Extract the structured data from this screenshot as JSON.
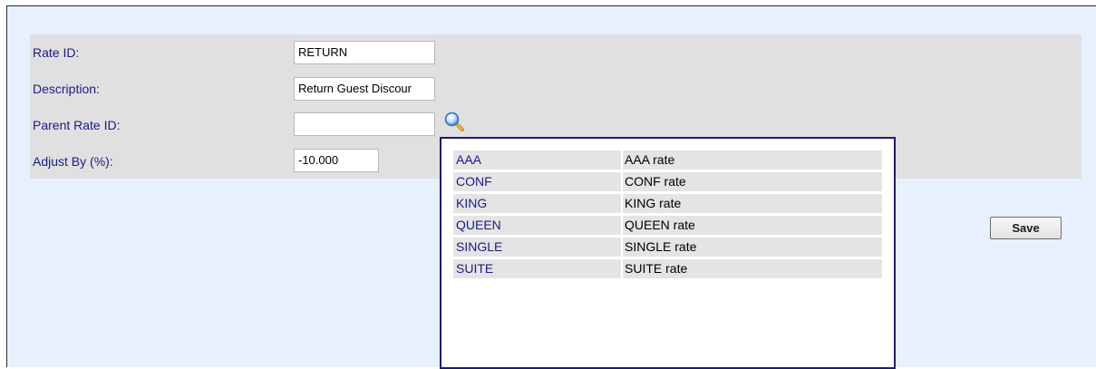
{
  "form": {
    "rate_id": {
      "label": "Rate ID:",
      "value": "RETURN"
    },
    "description": {
      "label": "Description:",
      "value": "Return Guest Discour"
    },
    "parent_rate_id": {
      "label": "Parent Rate ID:",
      "value": ""
    },
    "adjust_by": {
      "label": "Adjust By (%):",
      "value": "-10.000"
    }
  },
  "lookup": {
    "icon": "magnifier-search-icon",
    "items": [
      {
        "code": "AAA",
        "description": "AAA rate"
      },
      {
        "code": "CONF",
        "description": "CONF rate"
      },
      {
        "code": "KING",
        "description": "KING rate"
      },
      {
        "code": "QUEEN",
        "description": "QUEEN rate"
      },
      {
        "code": "SINGLE",
        "description": "SINGLE rate"
      },
      {
        "code": "SUITE",
        "description": "SUITE rate"
      }
    ]
  },
  "actions": {
    "save_label": "Save"
  },
  "colors": {
    "page_bg": "#e7f1fd",
    "panel_bg": "#e0e0e0",
    "label_text": "#1a1a8a",
    "popup_border": "#1c1c6e"
  }
}
